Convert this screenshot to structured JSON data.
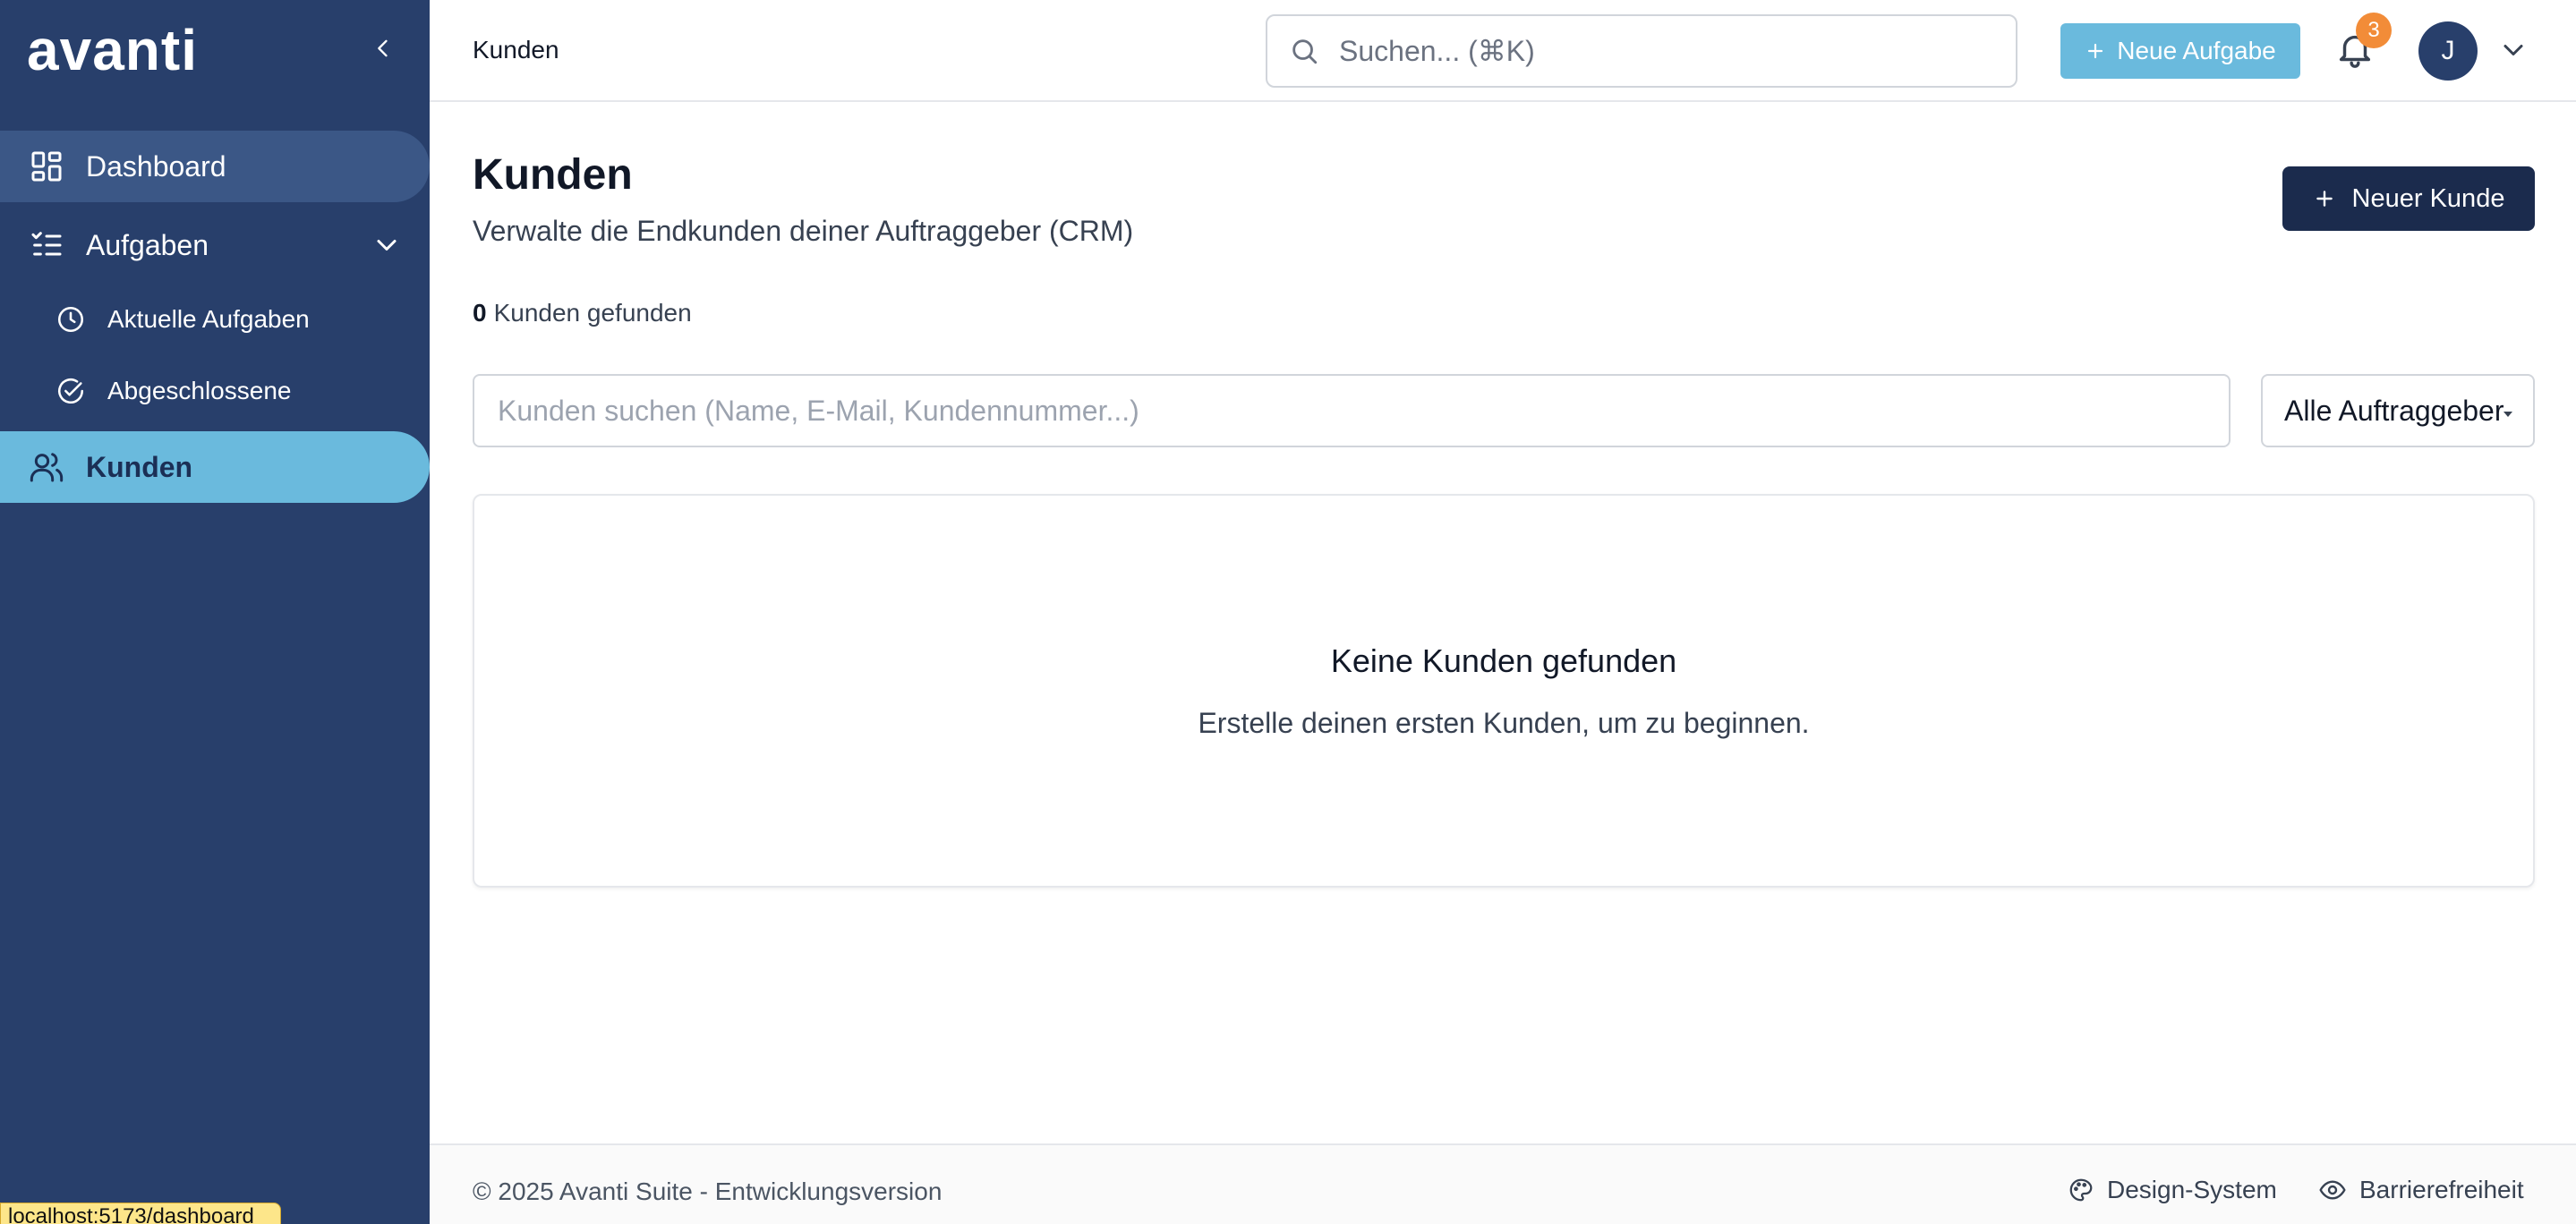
{
  "app": {
    "logo_text": "avanti",
    "status_url": "localhost:5173/dashboard"
  },
  "sidebar": {
    "items": [
      {
        "label": "Dashboard",
        "icon": "dashboard-icon",
        "active": false
      },
      {
        "label": "Aufgaben",
        "icon": "tasks-list-icon",
        "expanded": true
      },
      {
        "label": "Aktuelle Aufgaben",
        "icon": "clock-icon"
      },
      {
        "label": "Abgeschlossene",
        "icon": "check-circle-icon"
      },
      {
        "label": "Kunden",
        "icon": "users-icon",
        "active": true
      }
    ]
  },
  "header": {
    "breadcrumb": "Kunden",
    "search_placeholder": "Suchen... (⌘K)",
    "new_task_label": "Neue Aufgabe",
    "notification_count": "3",
    "avatar_initial": "J"
  },
  "main": {
    "title": "Kunden",
    "subtitle": "Verwalte die Endkunden deiner Auftraggeber (CRM)",
    "new_customer_label": "Neuer Kunde",
    "count_value": "0",
    "count_text": "Kunden gefunden",
    "filter_placeholder": "Kunden suchen (Name, E-Mail, Kundennummer...)",
    "client_filter_selected": "Alle Auftraggeber",
    "empty_title": "Keine Kunden gefunden",
    "empty_text": "Erstelle deinen ersten Kunden, um zu beginnen."
  },
  "footer": {
    "copyright": "© 2025 Avanti Suite - Entwicklungsversion",
    "design_system_label": "Design-System",
    "accessibility_label": "Barrierefreiheit"
  },
  "colors": {
    "sidebar_bg": "#283f6b",
    "sidebar_active": "#6abadd",
    "primary_dark": "#1b2b4d",
    "accent_light_blue": "#6abadd",
    "badge_orange": "#f28c38"
  }
}
